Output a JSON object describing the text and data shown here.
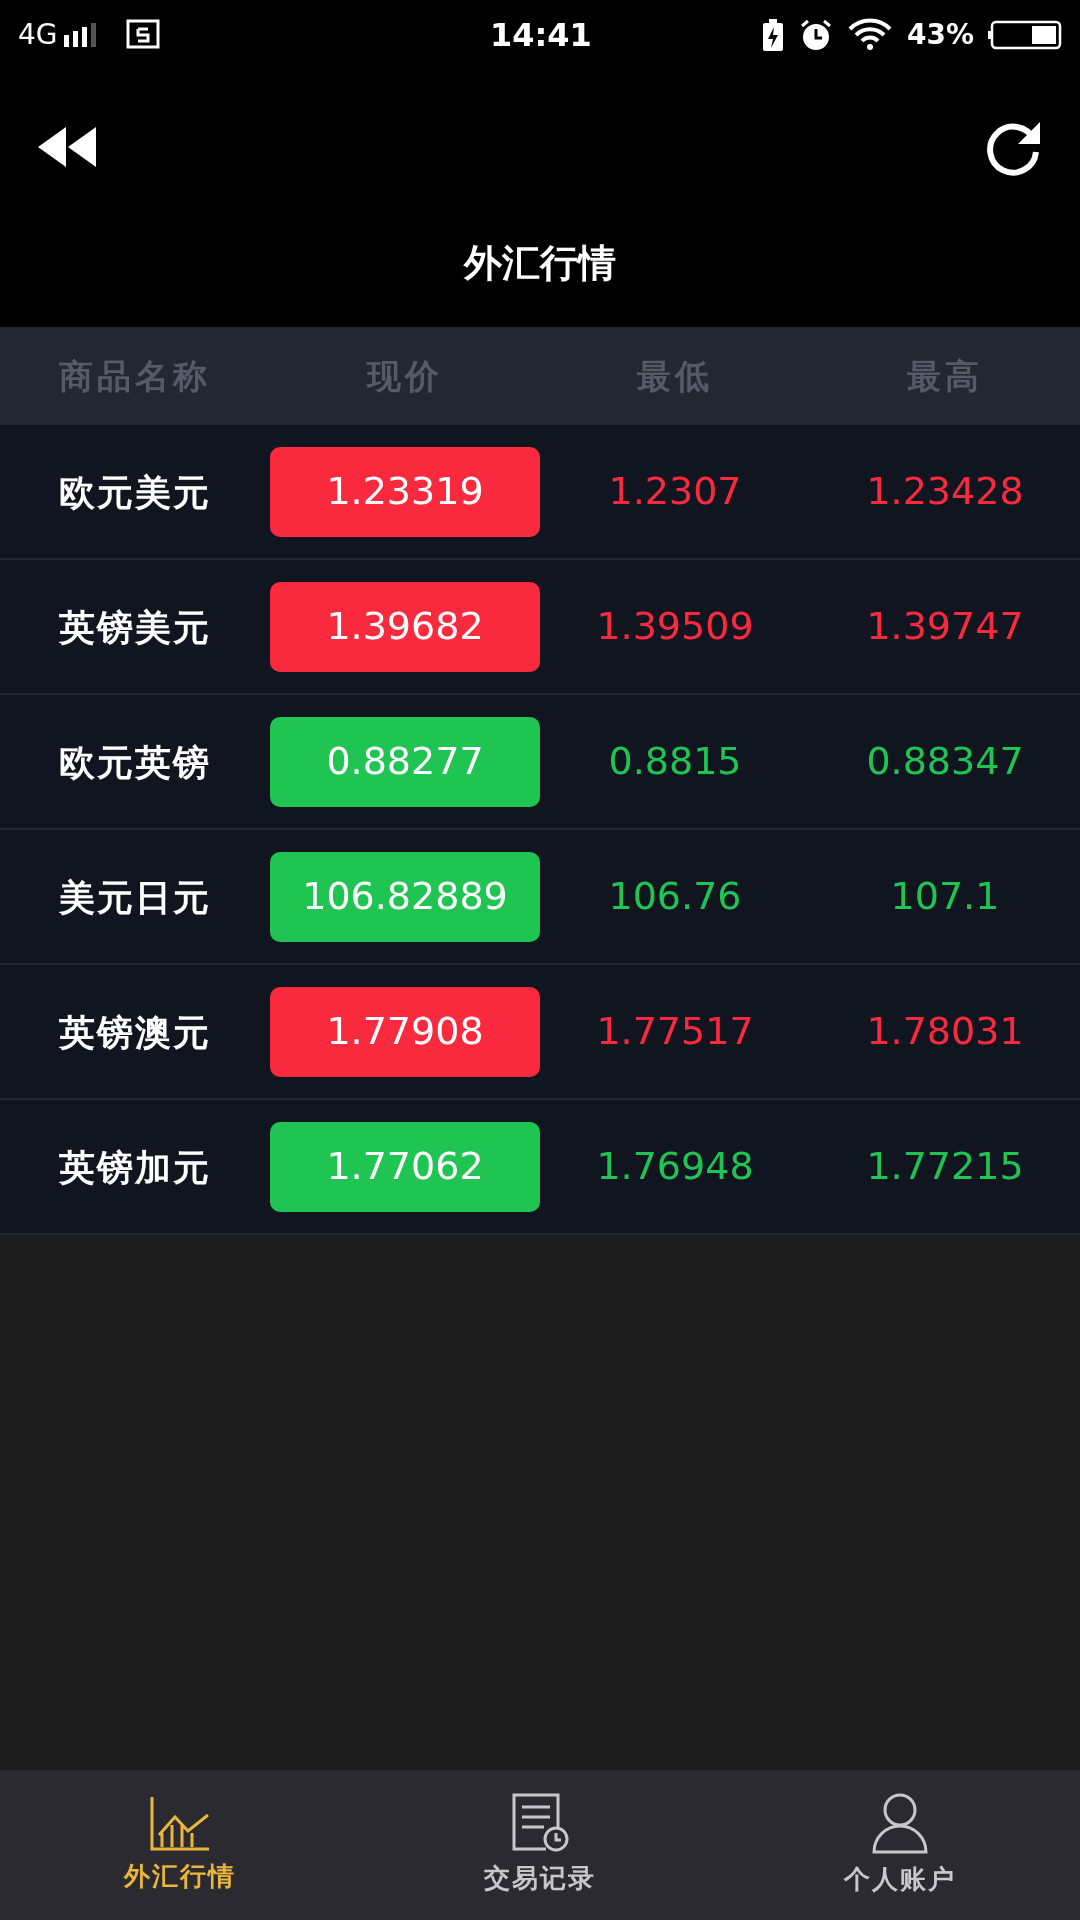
{
  "status_bar": {
    "network": "4G",
    "time": "14:41",
    "battery": "43%"
  },
  "header": {
    "title": "外汇行情"
  },
  "table": {
    "columns": [
      "商品名称",
      "现价",
      "最低",
      "最高"
    ],
    "rows": [
      {
        "name": "欧元美元",
        "price": "1.23319",
        "low": "1.2307",
        "high": "1.23428",
        "color": "#fa2a3e"
      },
      {
        "name": "英镑美元",
        "price": "1.39682",
        "low": "1.39509",
        "high": "1.39747",
        "color": "#fa2a3e"
      },
      {
        "name": "欧元英镑",
        "price": "0.88277",
        "low": "0.8815",
        "high": "0.88347",
        "color": "#1fc453"
      },
      {
        "name": "美元日元",
        "price": "106.82889",
        "low": "106.76",
        "high": "107.1",
        "color": "#1fc453"
      },
      {
        "name": "英镑澳元",
        "price": "1.77908",
        "low": "1.77517",
        "high": "1.78031",
        "color": "#fa2a3e"
      },
      {
        "name": "英镑加元",
        "price": "1.77062",
        "low": "1.76948",
        "high": "1.77215",
        "color": "#1fc453"
      }
    ]
  },
  "tab_bar": [
    {
      "label": "外汇行情",
      "kind": "chart",
      "selected": true
    },
    {
      "label": "交易记录",
      "kind": "record",
      "selected": false
    },
    {
      "label": "个人账户",
      "kind": "person",
      "selected": false
    }
  ]
}
